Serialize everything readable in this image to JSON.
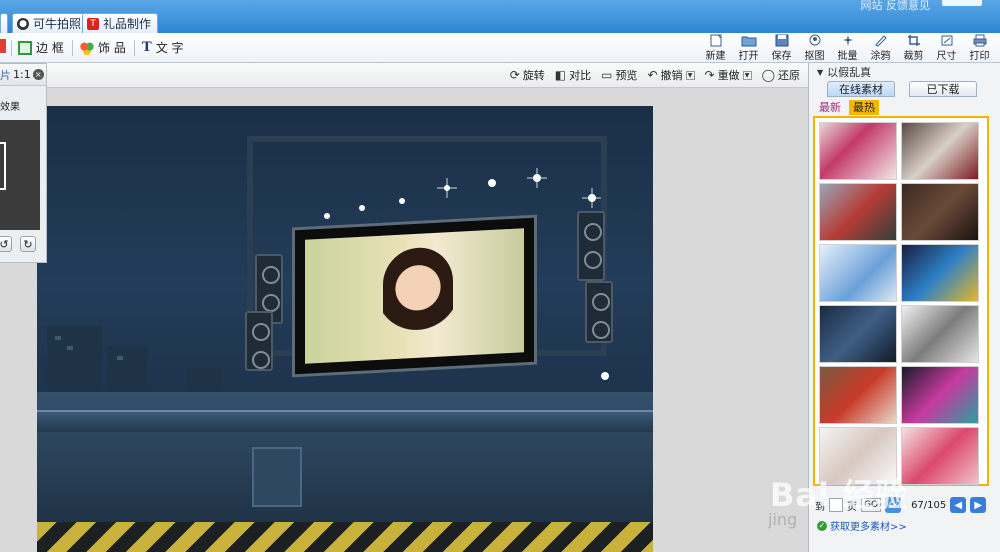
{
  "tabs": [
    {
      "label": "可牛拍照",
      "icon": "camera-icon"
    },
    {
      "label": "礼品制作",
      "icon": "gift-icon"
    }
  ],
  "top_right_text": "网站  反馈意见",
  "toolbar_left": [
    {
      "label": "边 框",
      "icon": "frame-icon"
    },
    {
      "label": "饰 品",
      "icon": "decoration-icon"
    },
    {
      "label": "文 字",
      "icon": "text-icon"
    }
  ],
  "toolbar_right": [
    {
      "label": "新建",
      "icon": "new-icon"
    },
    {
      "label": "打开",
      "icon": "open-folder-icon"
    },
    {
      "label": "保存",
      "icon": "save-icon"
    },
    {
      "label": "抠图",
      "icon": "cutout-icon"
    },
    {
      "label": "批量",
      "icon": "batch-icon"
    },
    {
      "label": "涂鸦",
      "icon": "doodle-icon"
    },
    {
      "label": "裁剪",
      "icon": "crop-icon"
    },
    {
      "label": "尺寸",
      "icon": "resize-icon"
    },
    {
      "label": "打印",
      "icon": "print-icon"
    }
  ],
  "subbar": {
    "rotate": "旋转",
    "compare": "对比",
    "preview": "预览",
    "undo": "撤销",
    "redo": "重做",
    "restore": "还原"
  },
  "left_panel": {
    "title_fragment": "片",
    "ratio": "1:1",
    "label": "效果"
  },
  "right_panel": {
    "header": "以假乱真",
    "tab_online": "在线素材",
    "tab_downloaded": "已下载",
    "subtab_new": "最新",
    "subtab_hot": "最热",
    "pager": {
      "to_label": "到",
      "page_label": "页",
      "go": "GO",
      "page_info": "67/105"
    },
    "more_link": "获取更多素材>>"
  },
  "watermark": {
    "line1": "Bai 经验",
    "line2": "jing"
  }
}
